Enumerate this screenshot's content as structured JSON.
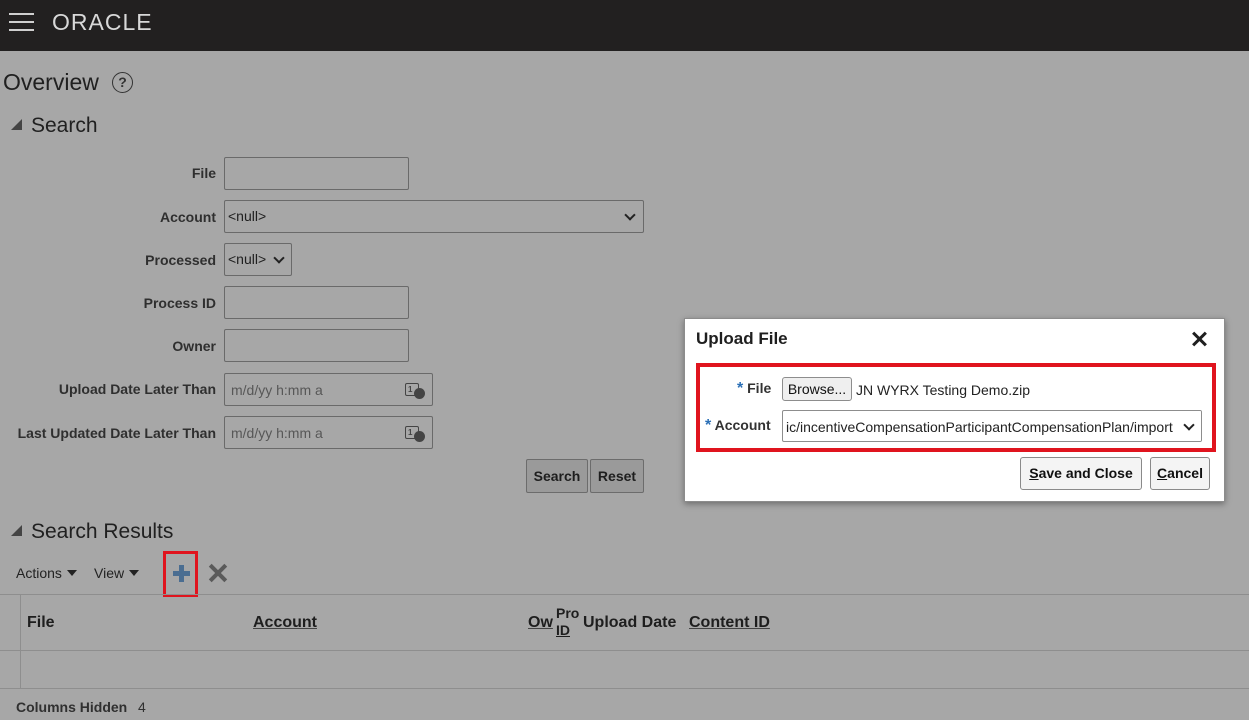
{
  "header": {
    "brand": "ORACLE"
  },
  "page": {
    "title": "Overview",
    "help_glyph": "?"
  },
  "search": {
    "heading": "Search",
    "fields": {
      "file": {
        "label": "File",
        "value": ""
      },
      "account": {
        "label": "Account",
        "value": "<null>"
      },
      "processed": {
        "label": "Processed",
        "value": "<null>"
      },
      "process_id": {
        "label": "Process ID",
        "value": ""
      },
      "owner": {
        "label": "Owner",
        "value": ""
      },
      "upload_date": {
        "label": "Upload Date Later Than",
        "placeholder": "m/d/yy h:mm a"
      },
      "last_updated": {
        "label": "Last Updated Date Later Than",
        "placeholder": "m/d/yy h:mm a"
      }
    },
    "buttons": {
      "search": "Search",
      "reset": "Reset"
    }
  },
  "results": {
    "heading": "Search Results",
    "toolbar": {
      "actions": "Actions",
      "view": "View"
    },
    "columns": {
      "file": "File",
      "account": "Account",
      "owner": "Ow",
      "process_id_top": "Pro",
      "process_id_bottom": "ID",
      "upload_date": "Upload Date",
      "content_id": "Content ID"
    },
    "footer": {
      "label": "Columns Hidden",
      "value": "4"
    }
  },
  "dialog": {
    "title": "Upload File",
    "required_mark": "*",
    "file_label": "File",
    "browse": "Browse...",
    "file_name": "JN WYRX Testing Demo.zip",
    "account_label": "Account",
    "account_value": "ic/incentiveCompensationParticipantCompensationPlan/import",
    "save_close_accel": "S",
    "save_close_rest": "ave and Close",
    "cancel_accel": "C",
    "cancel_rest": "ancel"
  },
  "colors": {
    "highlight": "#e0141e",
    "required": "#2a6fb6",
    "header_bg": "#222020",
    "overlay": "#a7a7a7"
  },
  "icons": [
    "hamburger-icon",
    "help-icon",
    "collapse-triangle-icon",
    "calendar-icon",
    "chevron-down-icon",
    "add-icon",
    "delete-icon",
    "close-icon"
  ]
}
